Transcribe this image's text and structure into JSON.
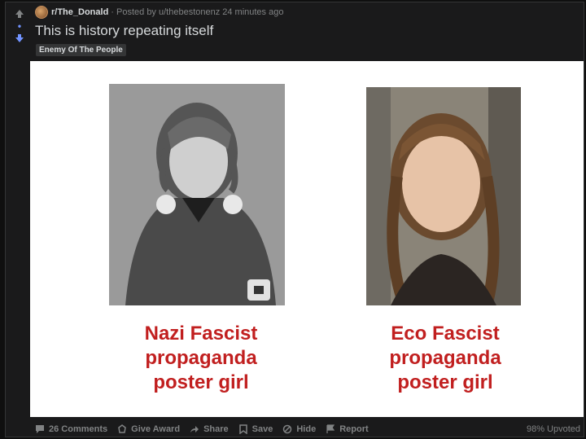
{
  "post": {
    "subreddit": "r/The_Donald",
    "posted_by": "· Posted by u/thebestonenz",
    "time": "24 minutes ago",
    "title": "This is history repeating itself",
    "flair": "Enemy Of The People",
    "score": "•"
  },
  "image": {
    "left_caption": [
      "Nazi Fascist",
      "propaganda",
      "poster girl"
    ],
    "right_caption": [
      "Eco Fascist",
      "propaganda",
      "poster girl"
    ]
  },
  "footer": {
    "comments": "26 Comments",
    "give_award": "Give Award",
    "share": "Share",
    "save": "Save",
    "hide": "Hide",
    "report": "Report",
    "upvoted": "98% Upvoted"
  },
  "colors": {
    "upvote": "#818384",
    "downvote": "#7193ff",
    "caption": "#c11f1f"
  }
}
